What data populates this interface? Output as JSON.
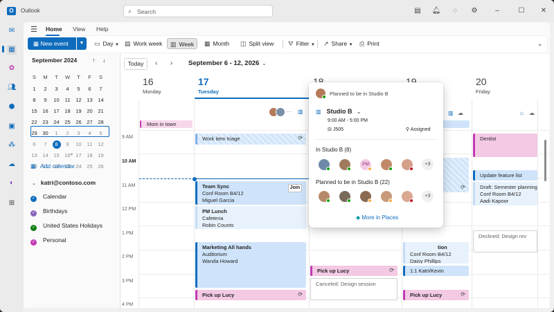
{
  "app": {
    "title": "Outlook",
    "logo": "O"
  },
  "search": {
    "placeholder": "Search"
  },
  "menu": {
    "tabs": [
      "Home",
      "View",
      "Help"
    ]
  },
  "ribbon": {
    "new_event": "New event",
    "day": "Day",
    "work_week": "Work week",
    "week": "Week",
    "month": "Month",
    "split_view": "Split view",
    "filter": "Filter",
    "share": "Share",
    "print": "Print"
  },
  "minical": {
    "title": "September 2024",
    "dow": [
      "S",
      "M",
      "T",
      "W",
      "T",
      "F",
      "S"
    ],
    "rows": [
      [
        "1",
        "2",
        "3",
        "4",
        "5",
        "6",
        "7"
      ],
      [
        "8",
        "9",
        "10",
        "11",
        "12",
        "13",
        "14"
      ],
      [
        "15",
        "16",
        "17",
        "18",
        "19",
        "20",
        "21"
      ],
      [
        "22",
        "23",
        "24",
        "25",
        "26",
        "27",
        "28"
      ],
      [
        "29",
        "30",
        "1",
        "2",
        "3",
        "4",
        "5"
      ],
      [
        "6",
        "7",
        "8",
        "9",
        "10",
        "11",
        "12"
      ],
      [
        "13",
        "14",
        "15",
        "16",
        "17",
        "18",
        "19"
      ],
      [
        "20",
        "21",
        "22",
        "23",
        "24",
        "25",
        "26"
      ]
    ]
  },
  "sidebar": {
    "add_calendar": "Add calendar",
    "account": "katri@contoso.com",
    "calendars": [
      {
        "name": "Calendar",
        "color": "#0f6cbd"
      },
      {
        "name": "Birthdays",
        "color": "#8764b8"
      },
      {
        "name": "United States Holidays",
        "color": "#107c10"
      },
      {
        "name": "Personal",
        "color": "#c239b3"
      }
    ]
  },
  "calendar": {
    "today_button": "Today",
    "range": "September 6 - 12, 2026",
    "days": [
      {
        "num": "16",
        "name": "Monday"
      },
      {
        "num": "17",
        "name": "Tuesday"
      },
      {
        "num": "18",
        "name": ""
      },
      {
        "num": "19",
        "name": ""
      },
      {
        "num": "20",
        "name": "Friday"
      }
    ],
    "hours": [
      "9 AM",
      "10 AM",
      "11 AM",
      "12 PM",
      "1 PM",
      "2 PM",
      "3 PM",
      "4 PM"
    ],
    "allday": {
      "mon": "Mom in town",
      "thu": "ite"
    },
    "events": {
      "triage": "Work item triage",
      "sync_t": "Team Sync",
      "sync_l": "Conf Room B4/12",
      "sync_p": "Miguel Garcia",
      "join": "Join",
      "lunch_t": "PM Lunch",
      "lunch_l": "Cafeteria",
      "lunch_p": "Robin Counts",
      "mkt_t": "Marketing All hands",
      "mkt_l": "Auditorium",
      "mkt_p": "Wanda Howard",
      "pick_tue": "Pick up Lucy",
      "pick_wed": "Pick up Lucy",
      "pick_thu": "Pick up Lucy",
      "canceled": "Canceled: Design session",
      "tion": "tion",
      "thu_l": "Conf Room B4/12",
      "thu_p": "Daisy Phillips",
      "katri": "1:1 Katri/Kevin",
      "dentist": "Dentist",
      "feature": "Update feature list",
      "draft": "Draft: Semester planning",
      "draft_l": "Conf Room B4/12",
      "draft_p": "Aadi Kapoor",
      "declined": "Declined: Design rev"
    }
  },
  "card": {
    "header": "Planned to be in Studio B",
    "place": "Studio B",
    "time": "9:00 AM - 5:00 PM",
    "desk": "J505",
    "assigned": "Assigned",
    "in_label": "In Studio B (8)",
    "planned_label": "Planned to be in Studio B (22)",
    "in_more": "+3",
    "planned_more": "+3",
    "initials": "PM",
    "more_places": "More in Places"
  }
}
